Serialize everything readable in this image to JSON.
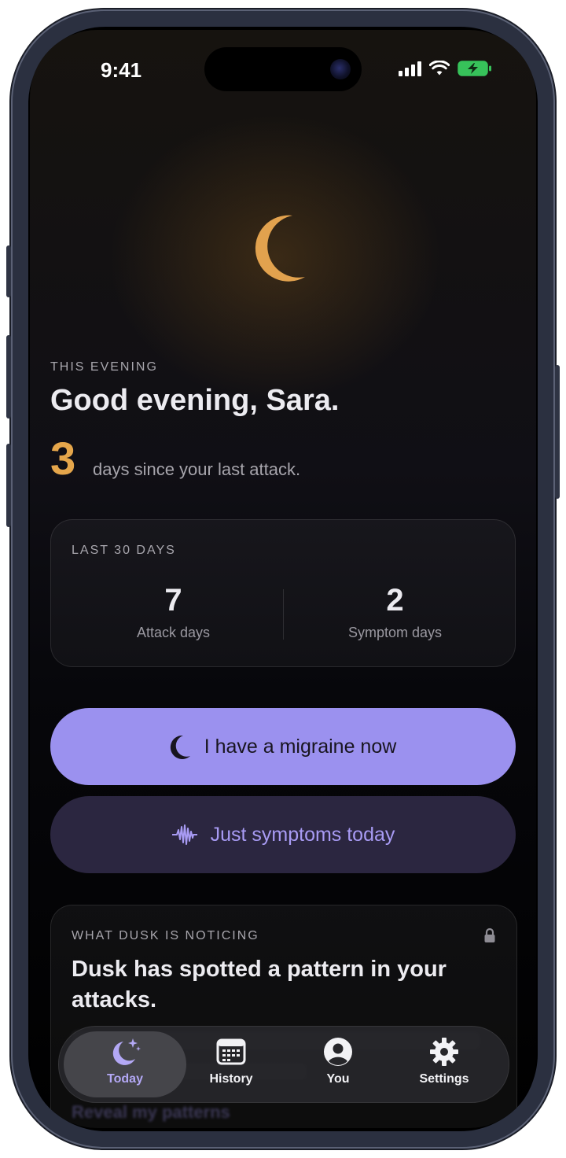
{
  "status_bar": {
    "time": "9:41"
  },
  "hero": {
    "eyebrow": "THIS EVENING",
    "greeting": "Good evening, Sara.",
    "days_since": "3",
    "days_since_text": "days since your last attack."
  },
  "stats": {
    "title": "LAST 30 DAYS",
    "items": [
      {
        "value": "7",
        "label": "Attack days"
      },
      {
        "value": "2",
        "label": "Symptom days"
      }
    ]
  },
  "actions": {
    "primary": "I have a migraine now",
    "secondary": "Just symptoms today"
  },
  "insight": {
    "title": "WHAT DUSK IS NOTICING",
    "headline": "Dusk has spotted a pattern in your attacks.",
    "reveal": "Reveal my patterns"
  },
  "tabbar": {
    "items": [
      {
        "label": "Today",
        "icon": "moon-sparkle-icon"
      },
      {
        "label": "History",
        "icon": "calendar-icon"
      },
      {
        "label": "You",
        "icon": "person-icon"
      },
      {
        "label": "Settings",
        "icon": "gear-icon"
      }
    ]
  },
  "colors": {
    "accent": "#9b91ef",
    "highlight": "#e5a64b",
    "secondary_button": "#2b2640"
  }
}
